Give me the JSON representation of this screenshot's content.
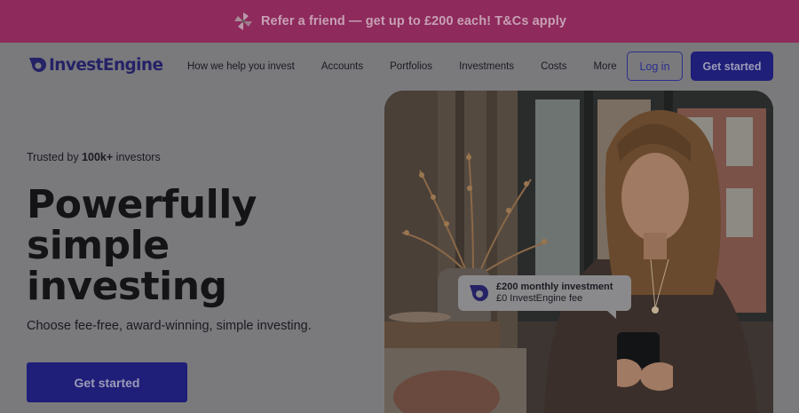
{
  "promo": {
    "text": "Refer a friend — get up to £200 each! T&Cs apply",
    "icon": "pinwheel-icon"
  },
  "nav": {
    "brand": "InvestEngine",
    "links": [
      "How we help you invest",
      "Accounts",
      "Portfolios",
      "Investments",
      "Costs",
      "More"
    ],
    "login_label": "Log in",
    "start_label": "Get started"
  },
  "hero": {
    "trusted_prefix": "Trusted by",
    "trusted_count": "100k+",
    "trusted_suffix": "investors",
    "headline": [
      "Powerfully",
      "simple",
      "investing"
    ],
    "subtext": "Choose fee-free, award-winning, simple investing.",
    "cta_label": "Get started"
  },
  "callout": {
    "title": "£200 monthly investment",
    "subtitle": "£0 InvestEngine fee"
  },
  "colors": {
    "promo_bg": "#8e2a5c",
    "brand": "#1f1e78",
    "page_bg": "#7a7a7d"
  }
}
